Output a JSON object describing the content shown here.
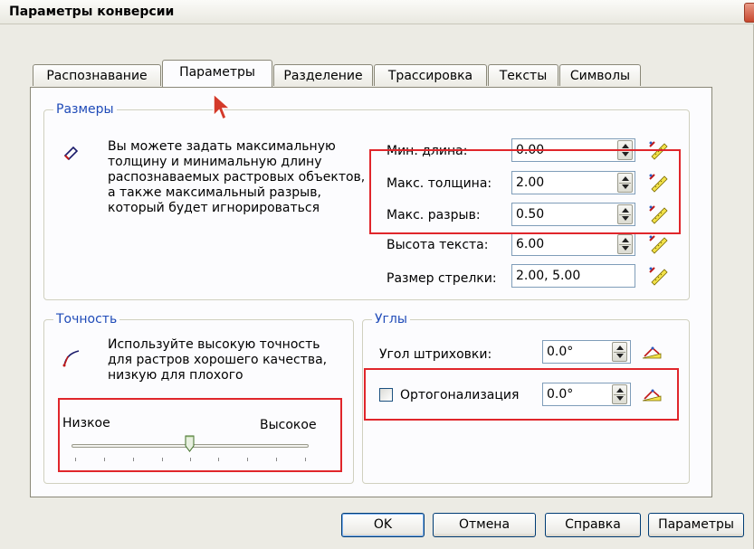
{
  "window": {
    "title": "Параметры конверсии"
  },
  "tabs": [
    {
      "label": "Распознавание"
    },
    {
      "label": "Параметры"
    },
    {
      "label": "Разделение"
    },
    {
      "label": "Трассировка"
    },
    {
      "label": "Тексты"
    },
    {
      "label": "Символы"
    }
  ],
  "sizes": {
    "title": "Размеры",
    "description": "Вы можете задать максимальную толщину и минимальную длину распознаваемых растровых объектов, а также максимальный разрыв, который будет игнорироваться",
    "fields": [
      {
        "label": "Мин. длина:",
        "value": "0.00"
      },
      {
        "label": "Макс. толщина:",
        "value": "2.00"
      },
      {
        "label": "Макс. разрыв:",
        "value": "0.50"
      },
      {
        "label": "Высота текста:",
        "value": "6.00"
      },
      {
        "label": "Размер стрелки:",
        "value": "2.00, 5.00"
      }
    ]
  },
  "precision": {
    "title": "Точность",
    "description": "Используйте высокую точность для растров хорошего качества, низкую для плохого",
    "low_label": "Низкое",
    "high_label": "Высокое",
    "slider_fraction": 0.5
  },
  "angles": {
    "title": "Углы",
    "hatch_label": "Угол штриховки:",
    "hatch_value": "0.0°",
    "ortho_label": "Ортогонализация",
    "ortho_checked": false,
    "ortho_value": "0.0°"
  },
  "buttons": {
    "ok": "OK",
    "cancel": "Отмена",
    "help": "Справка",
    "params": "Параметры"
  },
  "colors": {
    "accent": "#1f4bb8",
    "highlight": "#e0262b"
  },
  "icons": [
    "line-tool-icon",
    "ruler-pick-icon",
    "angle-pick-icon",
    "curve-tool-icon",
    "close-icon",
    "mouse-cursor-icon"
  ]
}
